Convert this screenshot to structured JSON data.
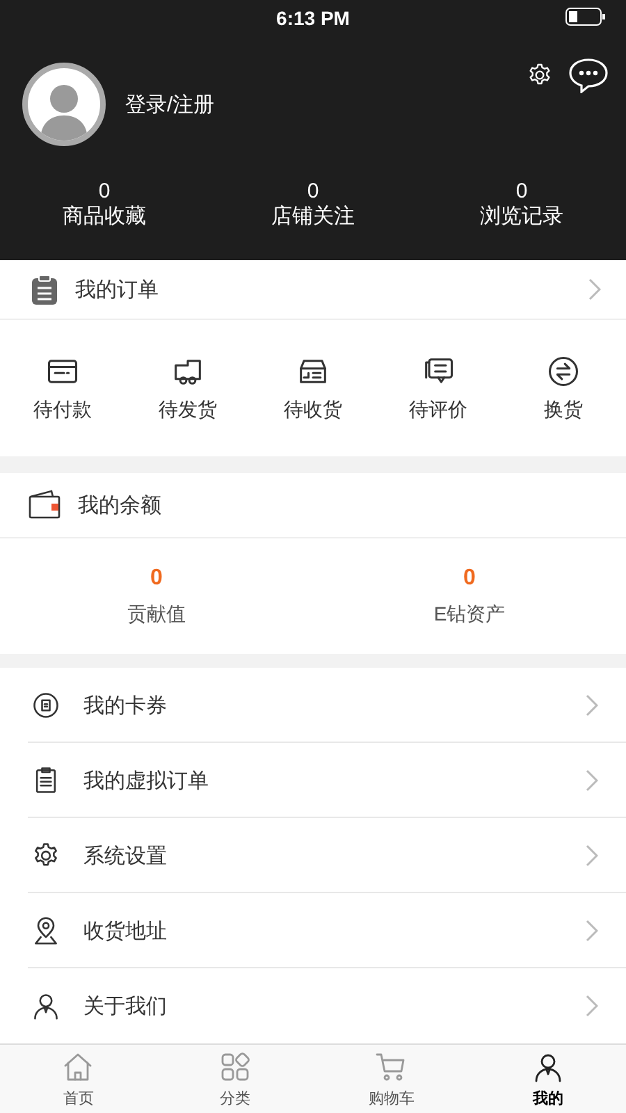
{
  "status_bar": {
    "time": "6:13 PM"
  },
  "profile": {
    "login_label": "登录/注册"
  },
  "stats": [
    {
      "value": "0",
      "label": "商品收藏"
    },
    {
      "value": "0",
      "label": "店铺关注"
    },
    {
      "value": "0",
      "label": "浏览记录"
    }
  ],
  "orders": {
    "title": "我的订单",
    "items": [
      {
        "label": "待付款",
        "kind": "card"
      },
      {
        "label": "待发货",
        "kind": "truck"
      },
      {
        "label": "待收货",
        "kind": "box"
      },
      {
        "label": "待评价",
        "kind": "comment"
      },
      {
        "label": "换货",
        "kind": "exchange"
      }
    ]
  },
  "balance": {
    "title": "我的余额",
    "items": [
      {
        "value": "0",
        "label": "贡献值"
      },
      {
        "value": "0",
        "label": "E钻资产"
      }
    ]
  },
  "menu": [
    {
      "label": "我的卡券",
      "kind": "coupon"
    },
    {
      "label": "我的虚拟订单",
      "kind": "list"
    },
    {
      "label": "系统设置",
      "kind": "gear"
    },
    {
      "label": "收货地址",
      "kind": "pin"
    },
    {
      "label": "关于我们",
      "kind": "person"
    }
  ],
  "tabs": [
    {
      "label": "首页",
      "kind": "home",
      "selected": false
    },
    {
      "label": "分类",
      "kind": "grid",
      "selected": false
    },
    {
      "label": "购物车",
      "kind": "cart",
      "selected": false
    },
    {
      "label": "我的",
      "kind": "person",
      "selected": true
    }
  ]
}
